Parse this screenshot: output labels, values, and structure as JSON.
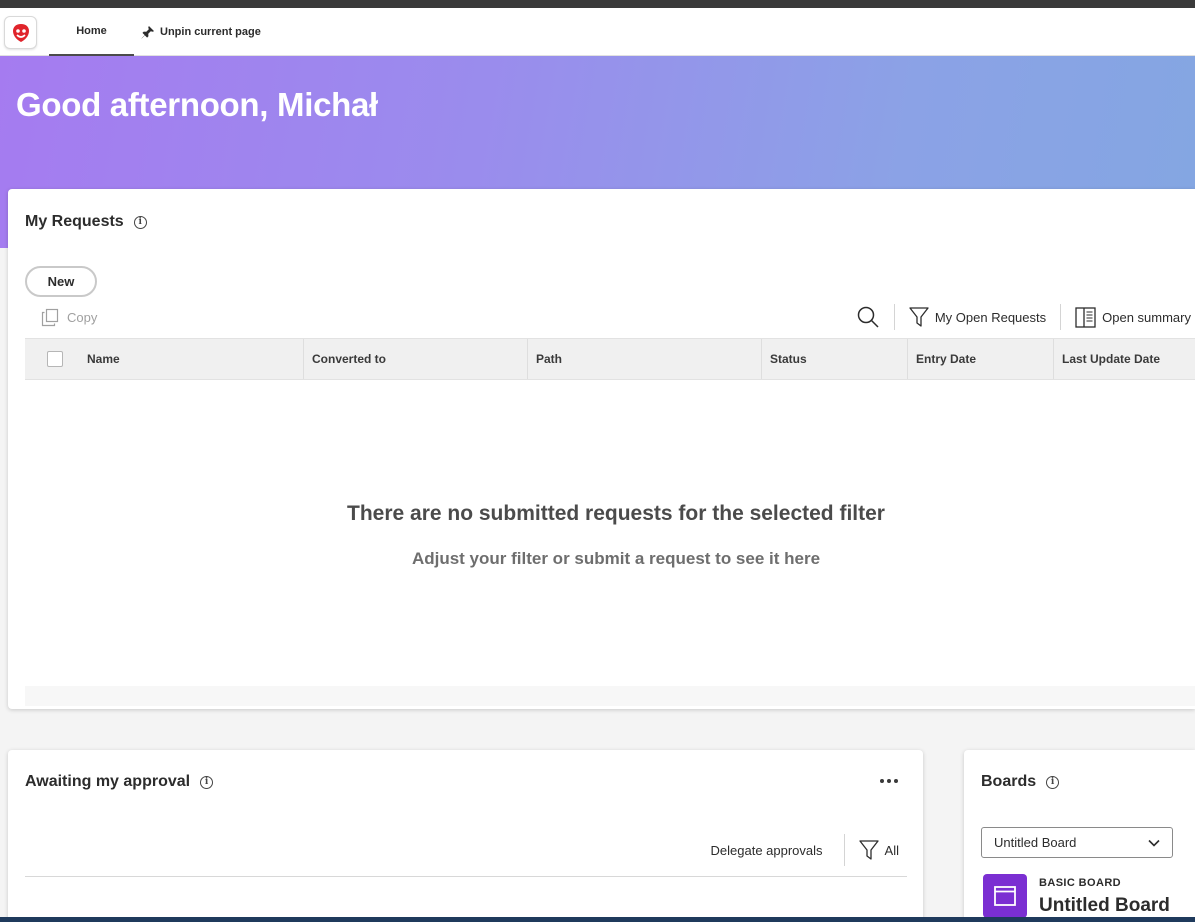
{
  "nav": {
    "home_label": "Home",
    "unpin_label": "Unpin current page"
  },
  "hero": {
    "greeting": "Good afternoon, Michał"
  },
  "requests": {
    "title": "My Requests",
    "new_label": "New",
    "copy_label": "Copy",
    "filter_label": "My Open Requests",
    "summary_label": "Open summary",
    "columns": [
      "Name",
      "Converted to",
      "Path",
      "Status",
      "Entry Date",
      "Last Update Date"
    ],
    "empty_title": "There are no submitted requests for the selected filter",
    "empty_subtitle": "Adjust your filter or submit a request to see it here"
  },
  "approval": {
    "title": "Awaiting my approval",
    "delegate_label": "Delegate approvals",
    "filter_label": "All"
  },
  "boards": {
    "title": "Boards",
    "selected_board": "Untitled Board",
    "board_type": "BASIC BOARD",
    "board_name": "Untitled Board"
  },
  "colors": {
    "accent_purple": "#7b2fd2",
    "hero_gradient_start": "#a57bf0",
    "hero_gradient_end": "#84a6e2",
    "logo_red": "#e0242b"
  }
}
